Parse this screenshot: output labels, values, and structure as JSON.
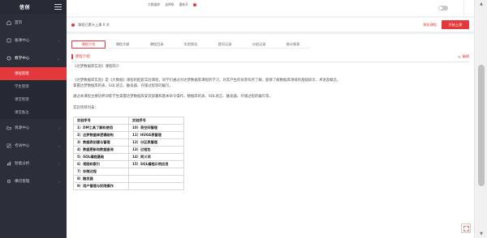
{
  "app": {
    "name": "信创"
  },
  "sidebar": {
    "items": [
      {
        "label": "首页",
        "icon": "home-icon"
      },
      {
        "label": "备课中心",
        "icon": "book-icon"
      },
      {
        "label": "教学中心",
        "icon": "teach-icon"
      },
      {
        "label": "资源中心",
        "icon": "folder-icon"
      },
      {
        "label": "考试中心",
        "icon": "exam-icon"
      },
      {
        "label": "智能分析",
        "icon": "chart-icon"
      },
      {
        "label": "横切管理",
        "icon": "gear-icon"
      }
    ],
    "subitems": [
      {
        "label": "课程管理"
      },
      {
        "label": "学生管理"
      },
      {
        "label": "课堂管理"
      },
      {
        "label": "课堂备注"
      }
    ]
  },
  "topstrip": {
    "items": [
      "大数据库",
      "选择框",
      "重新开"
    ]
  },
  "status": {
    "text": "课程已累计上课 0 次",
    "preview": "预览课程",
    "start": "开始上课"
  },
  "tabs": [
    "课程介绍",
    "课程大纲",
    "课程目录",
    "实验报告",
    "提问记录",
    "分组记录",
    "统计报表"
  ],
  "section": {
    "title": "课程介绍",
    "edit": "编辑"
  },
  "intro": {
    "p1": "《达梦数据库实验》课程简介",
    "p2": "《达梦数据库实验》是《大数据》课程的配套实验课程，同学们通过对达梦数据库课程的学习，对其产生的背景有所了解，能够了解数据库领域的基础知识、术语及概念，掌握达梦数据库的表、SQL语言、触发器、存储过程等的编写。",
    "p3": "通过本课程主要培养训练学生掌握达梦数据库安装部署和基本命令操作，数据库的表、SQL语言、触发器、存储过程的编写等。",
    "p4": "实验项目列表："
  },
  "table": {
    "headers": [
      "实验序号",
      "实验序号"
    ],
    "rows": [
      [
        "1）DM工具了解和使用",
        "10）表空间管理"
      ],
      [
        "2）达梦数据库逻辑结构",
        "11）HUGE表管理"
      ],
      [
        "3）数据表创建与管理",
        "12）分区表管理"
      ],
      [
        "4）数据更新和数据查询",
        "13）过程包"
      ],
      [
        "5）SQL编程基础",
        "14）同义词"
      ],
      [
        "6）视图和索引",
        "15）SQL编程示例应用"
      ],
      [
        "7）存储过程",
        ""
      ],
      [
        "8）触发器",
        ""
      ],
      [
        "9）用户管理与权限操作",
        ""
      ]
    ]
  },
  "colors": {
    "accent": "#e4393c",
    "sidebar": "#2b2f3a"
  }
}
